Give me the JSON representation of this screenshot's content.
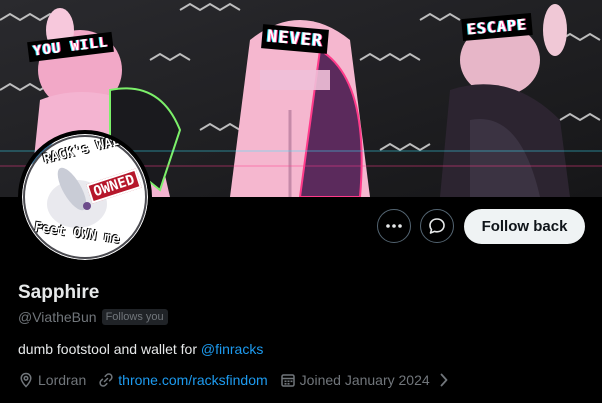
{
  "banner": {
    "words": [
      "YOU WILL",
      "NEVER",
      "ESCAPE"
    ]
  },
  "avatar": {
    "top_text": "RACK's WALLET",
    "stamp_text": "OWNED",
    "bottom_text": "Feet OWN me"
  },
  "actions": {
    "more_icon": "more-dots-icon",
    "message_icon": "message-bubble-icon",
    "follow_label": "Follow back"
  },
  "profile": {
    "name": "Sapphire",
    "handle": "@ViatheBun",
    "follows_you": "Follows you",
    "bio_text": "dumb footstool and wallet for ",
    "bio_mention": "@finracks",
    "location": "Lordran",
    "website": "throne.com/racksfindom",
    "joined": "Joined January 2024"
  },
  "colors": {
    "background": "#000000",
    "link": "#1d9bf0",
    "secondary_text": "#71767b",
    "follow_button_bg": "#eff3f4"
  }
}
